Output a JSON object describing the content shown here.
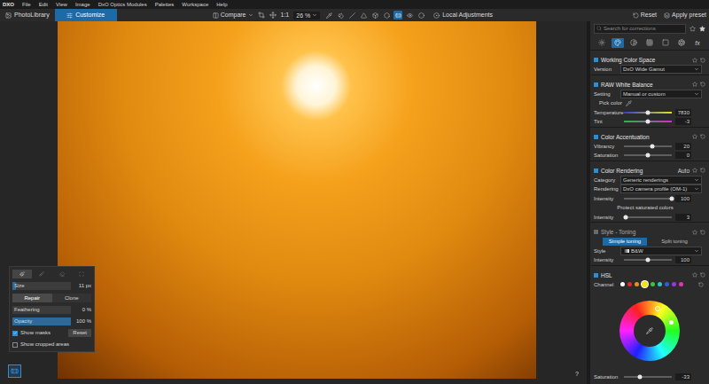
{
  "menu": {
    "logo": "DXO",
    "items": [
      "File",
      "Edit",
      "View",
      "Image",
      "DxO Optics Modules",
      "Palettes",
      "Workspace",
      "Help"
    ]
  },
  "toolbar": {
    "tabs": [
      {
        "label": "PhotoLibrary",
        "selected": false
      },
      {
        "label": "Customize",
        "selected": true
      }
    ],
    "compare": "Compare",
    "ratio": "1:1",
    "zoom": "26 %",
    "tools": [
      {
        "selected": false
      },
      {
        "selected": false
      },
      {
        "selected": false
      },
      {
        "selected": false
      },
      {
        "selected": false
      },
      {
        "selected": false
      },
      {
        "selected": true
      },
      {
        "selected": false
      },
      {
        "selected": false
      }
    ],
    "local_adjustments": "Local Adjustments",
    "reset": "Reset",
    "apply_preset": "Apply preset"
  },
  "viewer": {
    "help": "?",
    "repair_button": {
      "selected": true
    }
  },
  "repair_panel": {
    "tools": [
      {
        "selected": true
      },
      {
        "selected": false
      },
      {
        "selected": false
      },
      {
        "selected": false
      }
    ],
    "size": {
      "label": "Size",
      "level": 0.06,
      "reading": "11 px"
    },
    "modes": [
      {
        "label": "Repair",
        "selected": true
      },
      {
        "label": "Clone",
        "selected": false
      }
    ],
    "feathering": {
      "label": "Feathering",
      "level": 0,
      "reading": "0 %"
    },
    "opacity": {
      "label": "Opacity",
      "level": 1,
      "reading": "100 %"
    },
    "checkboxes": [
      {
        "label": "Show masks",
        "checked": true
      },
      {
        "label": "Show cropped areas",
        "checked": false
      }
    ],
    "reset": "Reset"
  },
  "right_panel": {
    "search": {
      "placeholder": "Search for corrections"
    },
    "tabs": [
      {
        "selected": false
      },
      {
        "selected": true
      },
      {
        "selected": false
      },
      {
        "selected": false
      },
      {
        "selected": false
      },
      {
        "selected": false
      },
      {
        "label": "fx",
        "selected": false
      }
    ],
    "sections": [
      {
        "title": "Working Color Space",
        "enabled": true,
        "rows": [
          {
            "kind": "dropdown",
            "label": "Version",
            "value": "DxO Wide Gamut",
            "has_icon": false
          }
        ]
      },
      {
        "title": "RAW White Balance",
        "enabled": true,
        "rows": [
          {
            "kind": "dropdown",
            "label": "Setting",
            "value": "Manual or custom",
            "has_icon": false
          },
          {
            "kind": "picker",
            "label": "Pick color"
          },
          {
            "kind": "slider",
            "label": "Temperature",
            "level": 0.5,
            "reading": "7830",
            "colors": [
              "#2f3fd6",
              "#e6e21c"
            ]
          },
          {
            "kind": "slider",
            "label": "Tint",
            "level": 0.5,
            "reading": "-3",
            "colors": [
              "#22b84a",
              "#d42ad0"
            ]
          }
        ]
      },
      {
        "title": "Color Accentuation",
        "enabled": true,
        "rows": [
          {
            "kind": "slider",
            "label": "Vibrancy",
            "level": 0.6,
            "reading": "20",
            "colors": []
          },
          {
            "kind": "slider",
            "label": "Saturation",
            "level": 0.5,
            "reading": "0",
            "colors": []
          }
        ]
      },
      {
        "title": "Color Rendering",
        "enabled": true,
        "extra": "Auto",
        "rows": [
          {
            "kind": "dropdown",
            "label": "Category",
            "value": "Generic renderings",
            "has_icon": false
          },
          {
            "kind": "dropdown",
            "label": "Rendering",
            "value": "DxO camera profile (OM-1)",
            "has_icon": false
          },
          {
            "kind": "slider",
            "label": "Intensity",
            "level": 1,
            "reading": "100",
            "colors": []
          },
          {
            "kind": "caption",
            "label": "Protect saturated colors"
          },
          {
            "kind": "slider",
            "label": "Intensity",
            "level": 0.03,
            "reading": "3",
            "colors": []
          }
        ]
      },
      {
        "title": "Style - Toning",
        "enabled": false,
        "rows": [
          {
            "kind": "segmented",
            "options": [
              {
                "label": "Simple toning",
                "selected": true
              },
              {
                "label": "Split toning",
                "selected": false
              }
            ]
          },
          {
            "kind": "dropdown",
            "label": "Style",
            "value": "B&W",
            "has_icon": true
          },
          {
            "kind": "slider",
            "label": "Intensity",
            "level": 0.5,
            "reading": "100",
            "colors": []
          }
        ]
      },
      {
        "title": "HSL",
        "enabled": true,
        "rows": [
          {
            "kind": "channels",
            "label": "Channel",
            "channels": [
              {
                "color": "#ffffff",
                "selected": false
              },
              {
                "color": "#e8262a",
                "selected": false
              },
              {
                "color": "#f28c1c",
                "selected": false
              },
              {
                "color": "#f2e21c",
                "selected": true
              },
              {
                "color": "#3cc43c",
                "selected": false
              },
              {
                "color": "#2ec4c4",
                "selected": false
              },
              {
                "color": "#2f5de0",
                "selected": false
              },
              {
                "color": "#9b35e0",
                "selected": false
              },
              {
                "color": "#e035b0",
                "selected": false
              }
            ]
          },
          {
            "kind": "wheel"
          },
          {
            "kind": "slider",
            "label": "Saturation",
            "level": 0.33,
            "reading": "-33",
            "colors": []
          }
        ]
      }
    ]
  }
}
